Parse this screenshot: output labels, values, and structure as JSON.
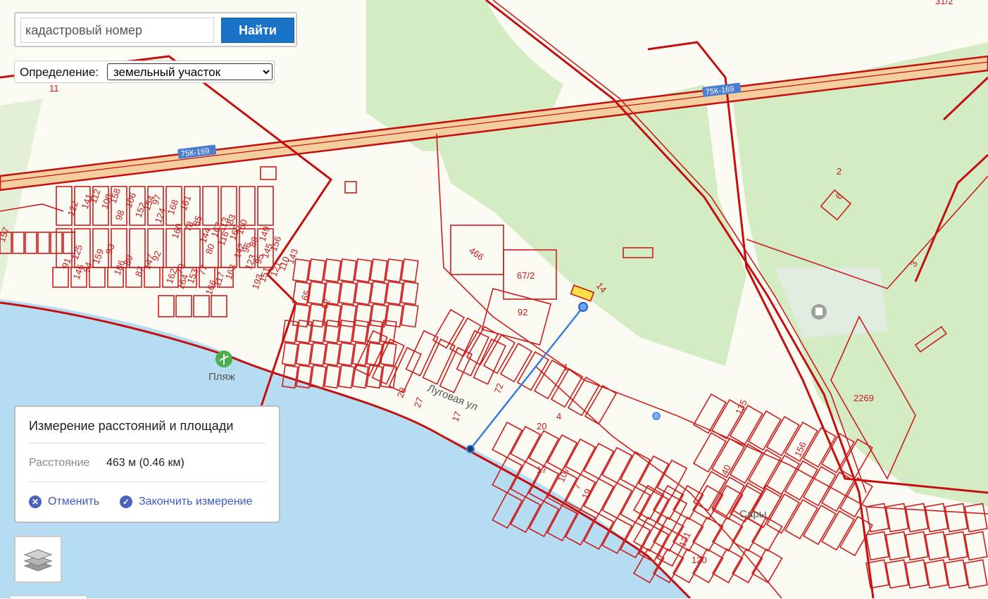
{
  "search": {
    "placeholder": "кадастровый номер",
    "button_label": "Найти"
  },
  "definition": {
    "label": "Определение:",
    "selected": "земельный участок"
  },
  "measurement": {
    "title": "Измерение расстояний и площади",
    "distance_label": "Расстояние",
    "distance_value": "463 м (0.46 км)",
    "cancel_label": "Отменить",
    "finish_label": "Закончить измерение"
  },
  "layers_button": {
    "icon": "layers-icon"
  },
  "map": {
    "road_badges": [
      "75К-169",
      "75К-169"
    ],
    "place_labels": [
      "Сары",
      "Пляж",
      "Луговая ул"
    ],
    "parcel_numbers": [
      "11",
      "157",
      "122",
      "141",
      "112",
      "100",
      "158",
      "98",
      "106",
      "152",
      "154",
      "97",
      "124",
      "168",
      "161",
      "160",
      "78",
      "85",
      "144",
      "167",
      "113",
      "83",
      "80",
      "116",
      "165",
      "150",
      "142",
      "96",
      "88",
      "149",
      "123",
      "95",
      "145",
      "156",
      "151",
      "121",
      "110",
      "143",
      "91",
      "125",
      "146",
      "94",
      "159",
      "93",
      "186",
      "89",
      "87",
      "147",
      "92",
      "162",
      "79",
      "164",
      "153",
      "77",
      "166",
      "117",
      "163",
      "193",
      "65",
      "62",
      "28",
      "27",
      "17",
      "72",
      "466",
      "67/2",
      "92",
      "14",
      "1",
      "20",
      "4",
      "17",
      "107",
      "7",
      "19",
      "2",
      "6",
      "3",
      "2269",
      "135",
      "156",
      "40",
      "121",
      "120",
      "31/2"
    ],
    "colors": {
      "parcel_border": "#cc1e1e",
      "water": "#b6dcf2",
      "forest": "#d3ecc3",
      "measure_line": "#3a7ed8",
      "road": "#f3cfa0"
    }
  }
}
